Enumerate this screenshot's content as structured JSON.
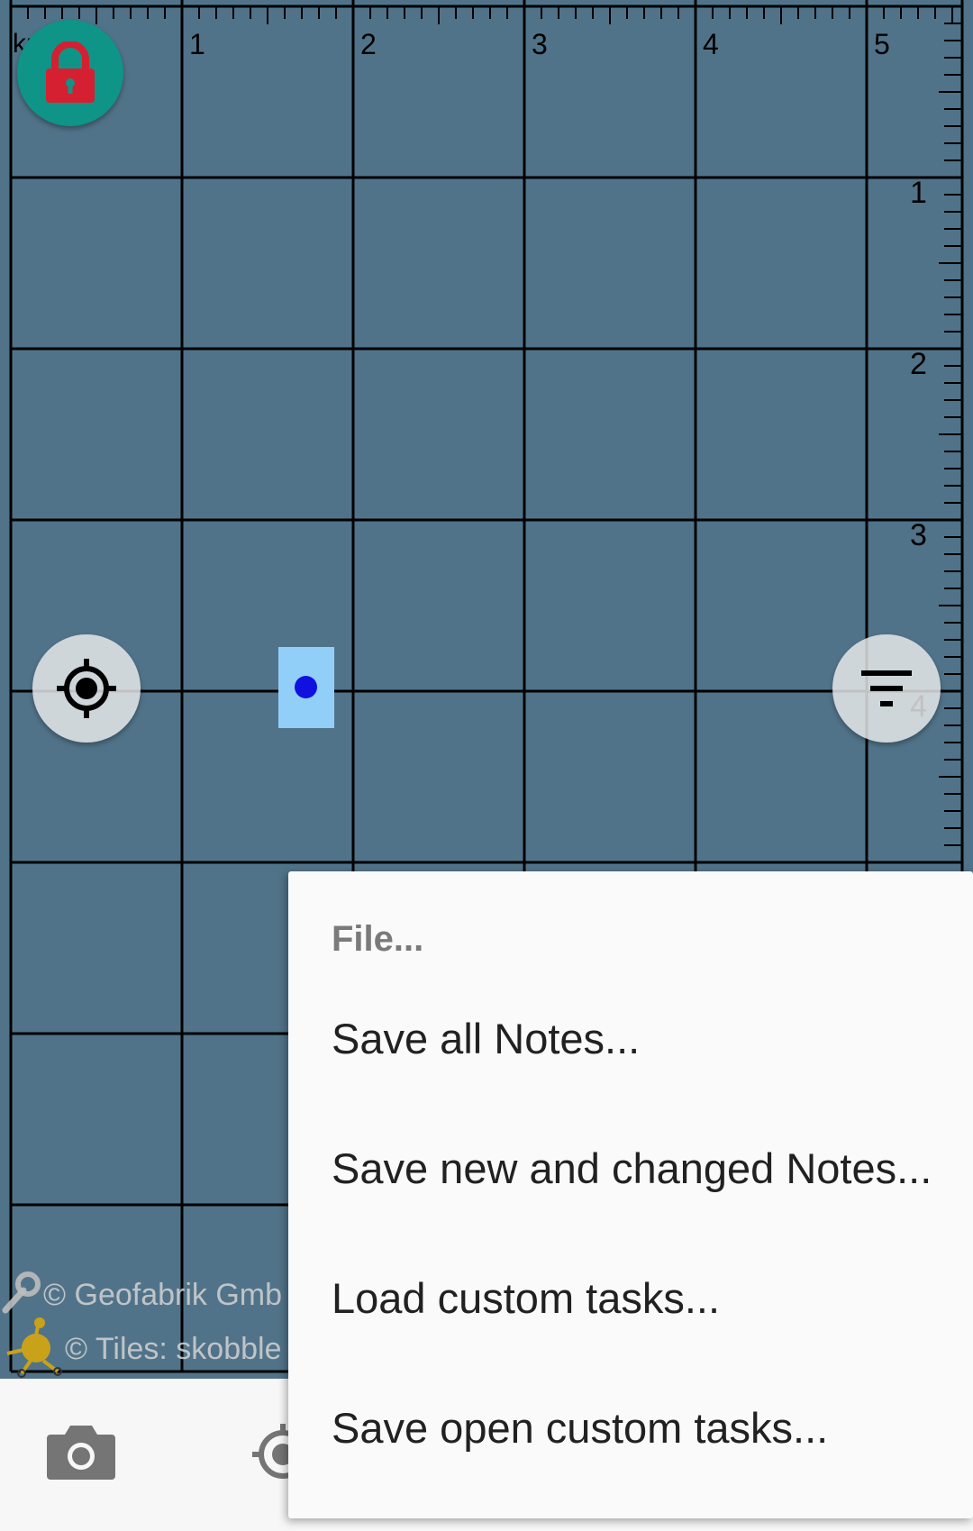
{
  "map": {
    "scale_unit_label": "km",
    "x_axis_labels": [
      "1",
      "2",
      "3",
      "4",
      "5"
    ],
    "y_axis_labels": [
      "1",
      "2",
      "3",
      "4"
    ],
    "background_color": "#517389",
    "grid_color": "#000000"
  },
  "buttons": {
    "lock_icon": "lock-icon",
    "locate_icon": "crosshair-icon",
    "filter_icon": "filter-icon"
  },
  "attribution": {
    "line1": "© Geofabrik Gmb",
    "line2": "© Tiles: skobble"
  },
  "bottom_bar": {
    "camera_icon": "camera-icon",
    "gps_icon": "gps-icon"
  },
  "menu": {
    "header": "File...",
    "items": [
      "Save all Notes...",
      "Save new and changed Notes...",
      "Load custom tasks...",
      "Save open custom tasks..."
    ]
  },
  "colors": {
    "lock_button": "#0f9488",
    "lock_icon": "#d42030",
    "selected_node_highlight": "#92cff8",
    "selected_node": "#1010e0"
  }
}
